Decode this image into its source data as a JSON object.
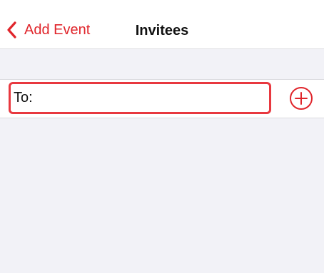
{
  "navbar": {
    "back_label": "Add Event",
    "title": "Invitees"
  },
  "invitees": {
    "to_label": "To:",
    "to_value": ""
  },
  "icons": {
    "back": "chevron-left-icon",
    "add": "plus-circle-icon"
  },
  "colors": {
    "accent": "#e0252b",
    "highlight_border": "#e8383f",
    "background": "#f2f2f7"
  }
}
